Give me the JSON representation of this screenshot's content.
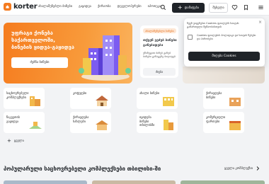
{
  "header": {
    "logo_text": "korter",
    "nav": [
      "ახალაშენებლი ბინები",
      "გაყიდვა",
      "ქირაობა",
      "დეველოპერები",
      "იპოთეკა"
    ],
    "add_button": "დამატება",
    "login_button": "შესვლა"
  },
  "hero": {
    "title": "უფრაგი ქონება საქართველოში, ბინების ყიდვა-გაყიდვა",
    "button": "ძებნა ბინები"
  },
  "promo_card": {
    "tag": "ახალაშენებლი ბინები",
    "title": "თქვენ ვეძებ ბინები განებადება",
    "description": "ეწინეგით ბინებ განებ ბინები განაგენე ბილავებ",
    "button": "ძიება"
  },
  "cookie": {
    "text": "ჩვენ ვიყენებთ Cookies ფაილებს საიტის გამართული მუშაობისთვის",
    "line": "Cookies ფაილების პოლიტიკა და საიტის წესები და პირობები",
    "button": "მიღება Cookies"
  },
  "tiles": [
    {
      "label": "საცხოვრებელი კომპლექსები"
    },
    {
      "label": "კოტეჯები"
    },
    {
      "label": "ახალი ბინები"
    },
    {
      "label": "ქირავდება ბინები"
    },
    {
      "label": "ნაკვეთის გაყიდვა"
    },
    {
      "label": "ქირავდება სახლები"
    },
    {
      "label": "იყიდება ბინები თბილისში"
    },
    {
      "label": "კომერციული ფართები"
    }
  ],
  "more_label": "ყველა",
  "section": {
    "title": "პოპულარული საცხოვრებელი კომპლექსები თბილისი-ში",
    "see_all": "ყველა კომპლექსი"
  },
  "colors": {
    "brand": "#f47b20",
    "dark": "#1f2328",
    "bg": "#f2f3f5"
  },
  "icons": [
    "search-icon",
    "heart-icon",
    "bookmark-icon",
    "menu-icon",
    "close-icon",
    "chevron-right-icon",
    "plus-icon"
  ]
}
